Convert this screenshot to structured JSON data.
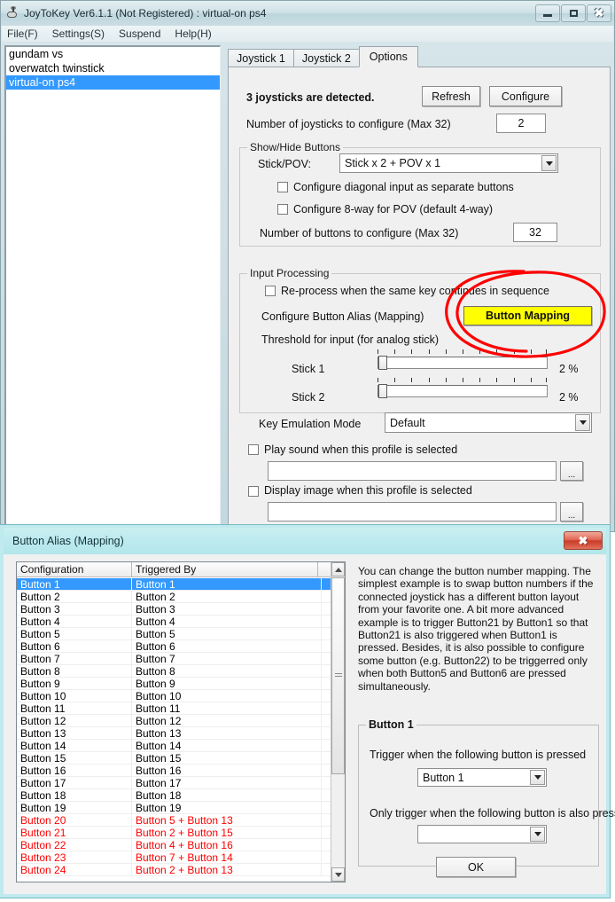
{
  "main_window": {
    "title": "JoyToKey Ver6.1.1 (Not Registered) : virtual-on ps4",
    "icon": "joystick-icon",
    "window_buttons": {
      "minimize": "minimize-icon",
      "maximize": "maximize-icon",
      "close": "close-icon"
    },
    "menu": [
      {
        "label": "File(F)"
      },
      {
        "label": "Settings(S)"
      },
      {
        "label": "Suspend"
      },
      {
        "label": "Help(H)"
      }
    ],
    "profiles": [
      {
        "label": "gundam vs",
        "selected": false
      },
      {
        "label": "overwatch twinstick",
        "selected": false
      },
      {
        "label": "virtual-on ps4",
        "selected": true
      }
    ],
    "tabs": [
      {
        "label": "Joystick 1",
        "active": false
      },
      {
        "label": "Joystick 2",
        "active": false
      },
      {
        "label": "Options",
        "active": true
      }
    ],
    "options": {
      "detected_text": "3 joysticks are detected.",
      "refresh_button": "Refresh",
      "configure_button": "Configure",
      "num_joysticks_label": "Number of joysticks to configure (Max 32)",
      "num_joysticks_value": "2",
      "show_hide_group": "Show/Hide Buttons",
      "stick_pov_label": "Stick/POV:",
      "stick_pov_value": "Stick x 2 + POV x 1",
      "diagonal_checkbox": "Configure diagonal input as separate buttons",
      "diagonal_checked": false,
      "eightway_checkbox": "Configure 8-way for POV (default 4-way)",
      "eightway_checked": false,
      "num_buttons_label": "Number of buttons to configure (Max 32)",
      "num_buttons_value": "32",
      "input_processing_group": "Input Processing",
      "reprocess_checkbox": "Re-process when the same key continues in sequence",
      "reprocess_checked": false,
      "button_alias_label": "Configure Button Alias (Mapping)",
      "button_mapping_button": "Button Mapping",
      "threshold_label": "Threshold for input (for analog stick)",
      "stick1_label": "Stick 1",
      "stick1_value": "2 %",
      "stick2_label": "Stick 2",
      "stick2_value": "2 %",
      "key_emulation_label": "Key Emulation Mode",
      "key_emulation_value": "Default",
      "play_sound_checkbox": "Play sound when this profile is selected",
      "play_sound_checked": false,
      "play_sound_path": "",
      "display_image_checkbox": "Display image when this profile is selected",
      "display_image_checked": false,
      "display_image_path": "",
      "browse_button": "..."
    },
    "annotation": {
      "color": "#ff0000",
      "shape": "hand-drawn-circle",
      "target": "Button Mapping"
    }
  },
  "dialog": {
    "title": "Button Alias (Mapping)",
    "close_button": "close-icon",
    "grid": {
      "columns": [
        "Configuration",
        "Triggered By"
      ],
      "rows": [
        {
          "config": "Button 1",
          "trigger": "Button 1",
          "red": false,
          "selected": true
        },
        {
          "config": "Button 2",
          "trigger": "Button 2",
          "red": false,
          "selected": false
        },
        {
          "config": "Button 3",
          "trigger": "Button 3",
          "red": false,
          "selected": false
        },
        {
          "config": "Button 4",
          "trigger": "Button 4",
          "red": false,
          "selected": false
        },
        {
          "config": "Button 5",
          "trigger": "Button 5",
          "red": false,
          "selected": false
        },
        {
          "config": "Button 6",
          "trigger": "Button 6",
          "red": false,
          "selected": false
        },
        {
          "config": "Button 7",
          "trigger": "Button 7",
          "red": false,
          "selected": false
        },
        {
          "config": "Button 8",
          "trigger": "Button 8",
          "red": false,
          "selected": false
        },
        {
          "config": "Button 9",
          "trigger": "Button 9",
          "red": false,
          "selected": false
        },
        {
          "config": "Button 10",
          "trigger": "Button 10",
          "red": false,
          "selected": false
        },
        {
          "config": "Button 11",
          "trigger": "Button 11",
          "red": false,
          "selected": false
        },
        {
          "config": "Button 12",
          "trigger": "Button 12",
          "red": false,
          "selected": false
        },
        {
          "config": "Button 13",
          "trigger": "Button 13",
          "red": false,
          "selected": false
        },
        {
          "config": "Button 14",
          "trigger": "Button 14",
          "red": false,
          "selected": false
        },
        {
          "config": "Button 15",
          "trigger": "Button 15",
          "red": false,
          "selected": false
        },
        {
          "config": "Button 16",
          "trigger": "Button 16",
          "red": false,
          "selected": false
        },
        {
          "config": "Button 17",
          "trigger": "Button 17",
          "red": false,
          "selected": false
        },
        {
          "config": "Button 18",
          "trigger": "Button 18",
          "red": false,
          "selected": false
        },
        {
          "config": "Button 19",
          "trigger": "Button 19",
          "red": false,
          "selected": false
        },
        {
          "config": "Button 20",
          "trigger": "Button 5 + Button 13",
          "red": true,
          "selected": false
        },
        {
          "config": "Button 21",
          "trigger": "Button 2 + Button 15",
          "red": true,
          "selected": false
        },
        {
          "config": "Button 22",
          "trigger": "Button 4 + Button 16",
          "red": true,
          "selected": false
        },
        {
          "config": "Button 23",
          "trigger": "Button 7 + Button 14",
          "red": true,
          "selected": false
        },
        {
          "config": "Button 24",
          "trigger": "Button 2 + Button 13",
          "red": true,
          "selected": false
        }
      ]
    },
    "description": "You can change the button number mapping.  The simplest example is to swap button numbers if the connected joystick has a different button layout from your favorite one.  A bit more advanced example is to trigger Button21 by Button1 so that Button21 is also triggered when Button1 is pressed.  Besides, it is also possible to configure some button (e.g. Button22) to be triggerred only when both Button5 and Button6 are pressed simultaneously.",
    "button_group": {
      "title": "Button 1",
      "trigger_label": "Trigger when the following button is pressed",
      "trigger_value": "Button 1",
      "modifier_label": "Only trigger when the following button is also pressed",
      "modifier_value": ""
    },
    "ok_button": "OK"
  },
  "colors": {
    "selection": "#3399ff",
    "highlight_yellow": "#ffff00",
    "annotation_red": "#ff0000",
    "dialog_titlebar": "#bdeaee",
    "main_titlebar": "#cfe1e7"
  }
}
